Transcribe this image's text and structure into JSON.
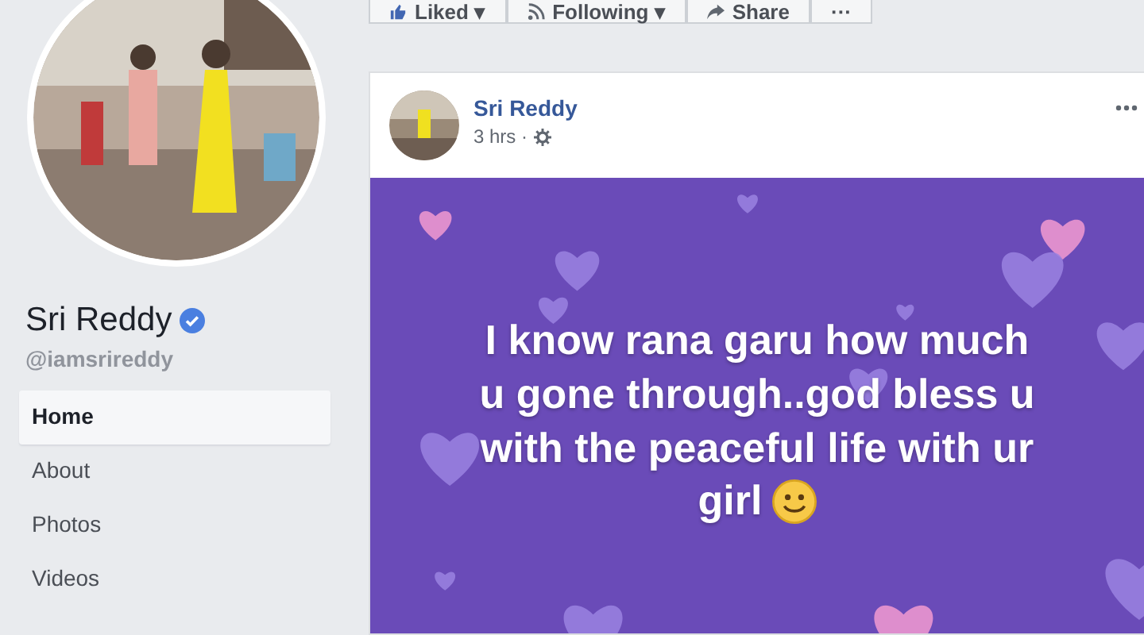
{
  "profile": {
    "name": "Sri Reddy",
    "verified": true,
    "username": "@iamsrireddy"
  },
  "nav": [
    {
      "label": "Home",
      "selected": true
    },
    {
      "label": "About",
      "selected": false
    },
    {
      "label": "Photos",
      "selected": false
    },
    {
      "label": "Videos",
      "selected": false
    }
  ],
  "actions": [
    {
      "kind": "like",
      "label": "Liked ▾"
    },
    {
      "kind": "follow",
      "label": "Following ▾"
    },
    {
      "kind": "share",
      "label": "Share"
    },
    {
      "kind": "more",
      "label": "···"
    }
  ],
  "post": {
    "author": "Sri Reddy",
    "time": "3 hrs ·",
    "text_lines": [
      "I know rana garu how much",
      "u gone through..god bless u",
      "with the peaceful life with ur",
      "girl"
    ]
  }
}
